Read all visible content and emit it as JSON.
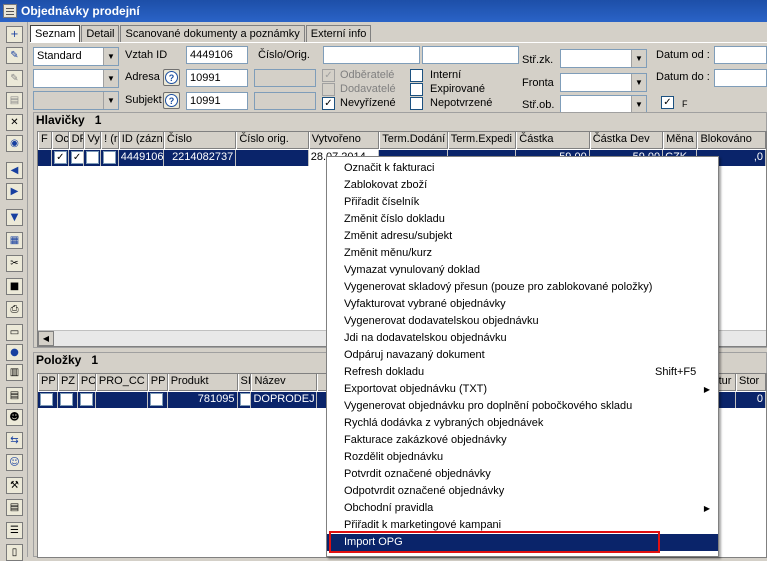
{
  "window": {
    "title": "Objednávky prodejní"
  },
  "tabs": [
    "Seznam",
    "Detail",
    "Scanované dokumenty a poznámky",
    "Externí info"
  ],
  "filters": {
    "combo1": "Standard",
    "combo2": "",
    "combo3": "",
    "vztah_id_label": "Vztah ID",
    "vztah_id_value": "4449106",
    "cislo_orig_label": "Číslo/Orig.",
    "cislo_orig_value1": "",
    "cislo_orig_value2": "",
    "adresa_label": "Adresa",
    "adresa_value": "10991",
    "subjekt_label": "Subjekt",
    "subjekt_value": "10991",
    "odberatele": "Odběratelé",
    "dodavatele": "Dodavatelé",
    "nevyrizene": "Nevyřízené",
    "interni": "Interní",
    "expirovane": "Expirované",
    "nepotvrzene": "Nepotvrzené",
    "strzk_label": "Stř.zk.",
    "fronta_label": "Fronta",
    "strob_label": "Stř.ob.",
    "datum_od_label": "Datum od :",
    "datum_do_label": "Datum do :",
    "f_label": "F",
    "q_icon": "?"
  },
  "hlavicky": {
    "title": "Hlavičky",
    "count": "1",
    "columns": [
      "F",
      "Oc",
      "DF",
      "Vy",
      "! (r",
      "ID (zázn",
      "Číslo",
      "Číslo orig.",
      "Vytvořeno",
      "Term.Dodání",
      "Term.Expedi",
      "Částka",
      "Částka Dev",
      "Měna",
      "Blokováno"
    ],
    "row": {
      "id": "4449106",
      "cislo": "2214082737",
      "vytvoreno": "28.07.2014",
      "castka": "59,00",
      "castka_dev": "59,00",
      "mena": "CZK",
      "blokovano": ",0"
    }
  },
  "polozky": {
    "title": "Položky",
    "count": "1",
    "columns": [
      "PP",
      "PZ",
      "PO",
      "PRO_CC",
      "PP",
      "Produkt",
      "SI",
      "Název",
      "ktur",
      "Stor"
    ],
    "row": {
      "produkt": "781095",
      "nazev": "DOPRODEJ B",
      "stor": "0"
    }
  },
  "context_menu": {
    "items": [
      "Označit k fakturaci",
      "Zablokovat zboží",
      "Přiřadit číselník",
      "Změnit číslo dokladu",
      "Změnit adresu/subjekt",
      "Změnit měnu/kurz",
      "Vymazat vynulovaný doklad",
      "Vygenerovat skladový přesun (pouze pro zablokované položky)",
      "Vyfakturovat vybrané objednávky",
      "Vygenerovat dodavatelskou objednávku",
      "Jdi na dodavatelskou objednávku",
      "Odpáruj navazaný dokument",
      "Refresh dokladu",
      "Exportovat objednávku (TXT)",
      "Vygenerovat objednávku pro doplnění pobočkového skladu",
      "Rychlá dodávka z vybraných objednávek",
      "Fakturace zakázkové objednávky",
      "Rozdělit objednávku",
      "Potvrdit označené objednávky",
      "Odpotvrdit označené objednávky",
      "Obchodní pravidla",
      "Přiřadit k marketingové kampani",
      "Import OPG"
    ],
    "refresh_shortcut": "Shift+F5",
    "submenu_arrow": "▶",
    "highlight_color": "#e01010",
    "selection_color": "#0a246a"
  }
}
